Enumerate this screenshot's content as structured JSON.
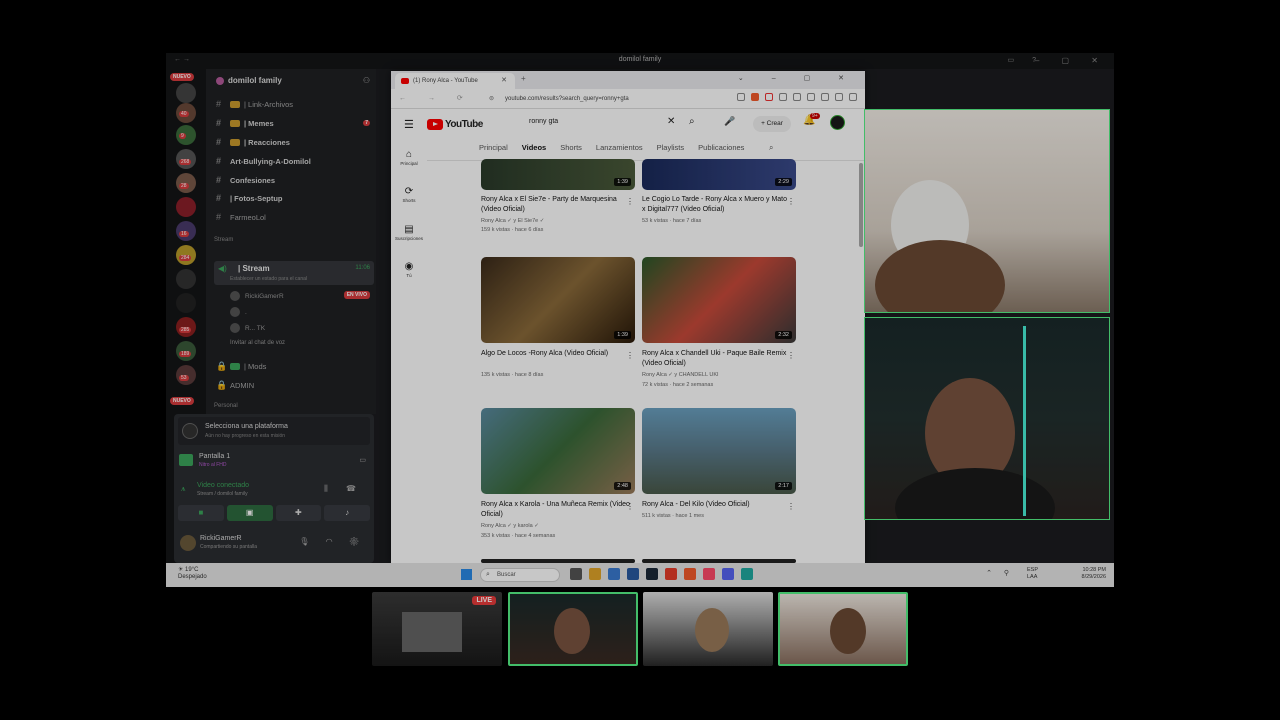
{
  "discord": {
    "title": "domilol family",
    "nuevo": "NUEVO",
    "server_badges": [
      "40",
      "9",
      "268",
      "28",
      "16",
      "284",
      "285",
      "189",
      "53"
    ],
    "guild_name": "domilol family",
    "channels": [
      {
        "label": "| Link-Archivos",
        "bold": false
      },
      {
        "label": "| Memes",
        "bold": true,
        "badge": "7"
      },
      {
        "label": "| Reacciones",
        "bold": true
      },
      {
        "label": "Art-Bullying-A-Domilol",
        "bold": true
      },
      {
        "label": "Confesiones",
        "bold": true
      },
      {
        "label": "| Fotos-Septup",
        "bold": true
      },
      {
        "label": "FarmeoLol",
        "bold": false
      }
    ],
    "category_stream": "Stream",
    "stream_channel": {
      "name": "| Stream",
      "sub": "Establecer un estado para el canal",
      "time": "11:06"
    },
    "voice_users": [
      {
        "name": "RickiGamerR",
        "live": "EN VIVO"
      },
      {
        "name": "."
      },
      {
        "name": "R... TK"
      }
    ],
    "invite_label": "Invitar al chat de voz",
    "locked_channels": [
      "| Mods",
      "ADMIN"
    ],
    "category_personal": "Personal",
    "platform": {
      "title": "Selecciona una plataforma",
      "sub": "Aún no hay progreso en esta misión"
    },
    "screen": {
      "title": "Pantalla 1",
      "sub": "Nitro al FHD"
    },
    "voice": {
      "title": "Video conectado",
      "sub": "Stream / domilol family"
    },
    "account": {
      "name": "RickiGamerR",
      "status": "Compartiendo su pantalla"
    }
  },
  "browser": {
    "tab_title": "(1) Rony Alca - YouTube",
    "url": "youtube.com/results?search_query=ronny+gta"
  },
  "youtube": {
    "logo": "YouTube",
    "search_value": "ronny gta",
    "create_label": "Crear",
    "notif_count": "9+",
    "left_nav": [
      {
        "icon": "⌂",
        "label": "Principal"
      },
      {
        "icon": "⟳",
        "label": "Shorts"
      },
      {
        "icon": "▤",
        "label": "Suscripciones"
      },
      {
        "icon": "◉",
        "label": "Tú"
      }
    ],
    "tabs": [
      "Principal",
      "Videos",
      "Shorts",
      "Lanzamientos",
      "Playlists",
      "Publicaciones"
    ],
    "active_tab": "Videos",
    "videos": [
      {
        "title": "Rony Alca x El Sie7e - Party de Marquesina (Video Oficial)",
        "channel": "Rony Alca ✓ y El Sie7e ✓",
        "meta": "159 k vistas · hace 6 días",
        "duration": "1:39"
      },
      {
        "title": "Le Cogio Lo Tarde - Rony Alca x Muero y Mato x Digital777 (Video Oficial)",
        "channel": "",
        "meta": "53 k vistas · hace 7 días",
        "duration": "2:29"
      },
      {
        "title": "Algo De Locos -Rony Alca (Video Oficial)",
        "channel": "",
        "meta": "135 k vistas · hace 8 días",
        "duration": "1:39"
      },
      {
        "title": "Rony Alca x Chandell Uki - Paque Baile Remix (Video Oficial)",
        "channel": "Rony Alca ✓ y CHANDELL UKI",
        "meta": "72 k vistas · hace 2 semanas",
        "duration": "2:32"
      },
      {
        "title": "Rony Alca x Karola - Una Muñeca Remix (Video Oficial)",
        "channel": "Rony Alca ✓ y karola ✓",
        "meta": "353 k vistas · hace 4 semanas",
        "duration": "2:48"
      },
      {
        "title": "Rony Alca - Del Kilo (Video Oficial)",
        "channel": "",
        "meta": "511 k vistas · hace 1 mes",
        "duration": "2:17"
      }
    ]
  },
  "taskbar": {
    "temp": "19°C",
    "weather": "Despejado",
    "search": "Buscar",
    "lang1": "ESP",
    "lang2": "LAA",
    "time": "10:28 PM",
    "date": "8/29/2026"
  },
  "thumbs": {
    "live": "LIVE"
  }
}
